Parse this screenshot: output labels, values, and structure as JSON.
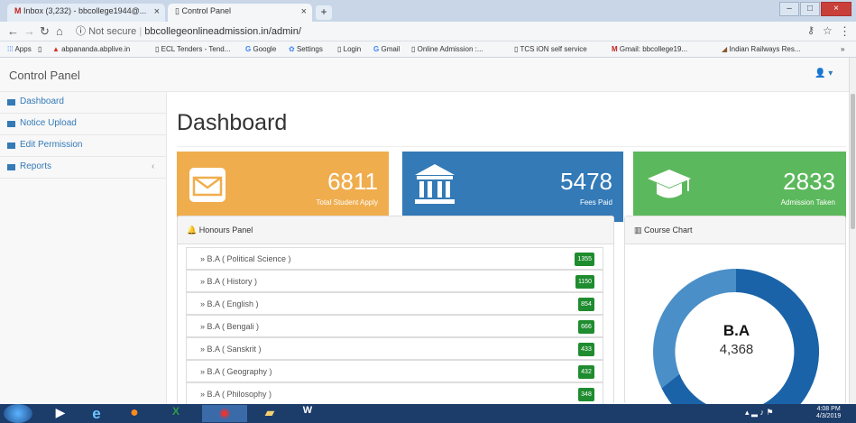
{
  "browser": {
    "tabs": [
      {
        "label": "Inbox (3,232) - bbcollege1944@..."
      },
      {
        "label": "Control Panel"
      }
    ],
    "url_secure": "Not secure",
    "url": "bbcollegeonlineadmission.in/admin/",
    "bookmarks": [
      "Apps",
      "abpananda.abplive.in",
      "ECL Tenders - Tend...",
      "Google",
      "Settings",
      "Login",
      "Gmail",
      "Online Admission :...",
      "TCS iON self service",
      "Gmail: bbcollege19...",
      "Indian Railways Res..."
    ]
  },
  "app": {
    "title": "Control Panel"
  },
  "sidebar": {
    "items": [
      {
        "label": "Dashboard"
      },
      {
        "label": "Notice Upload"
      },
      {
        "label": "Edit Permission"
      },
      {
        "label": "Reports"
      }
    ]
  },
  "page": {
    "title": "Dashboard"
  },
  "cards": [
    {
      "value": "6811",
      "label": "Total Student Apply",
      "color": "#f0ad4e",
      "icon": "envelope-icon"
    },
    {
      "value": "5478",
      "label": "Fees Paid",
      "color": "#337ab7",
      "icon": "bank-icon"
    },
    {
      "value": "2833",
      "label": "Admission Taken",
      "color": "#5cb85c",
      "icon": "graduation-cap-icon"
    }
  ],
  "honours": {
    "title": "Honours Panel",
    "rows": [
      {
        "label": "» B.A ( Political Science )",
        "count": "1355"
      },
      {
        "label": "» B.A ( History )",
        "count": "1150"
      },
      {
        "label": "» B.A ( English )",
        "count": "854"
      },
      {
        "label": "» B.A ( Bengali )",
        "count": "666"
      },
      {
        "label": "» B.A ( Sanskrit )",
        "count": "433"
      },
      {
        "label": "» B.A ( Geography )",
        "count": "432"
      },
      {
        "label": "» B.A ( Philosophy )",
        "count": "348"
      }
    ]
  },
  "course_chart": {
    "title": "Course Chart",
    "center_label": "B.A",
    "center_value": "4,368",
    "color": "#1a63a8"
  },
  "taskbar": {
    "time": "4:08 PM",
    "date": "4/3/2019"
  }
}
